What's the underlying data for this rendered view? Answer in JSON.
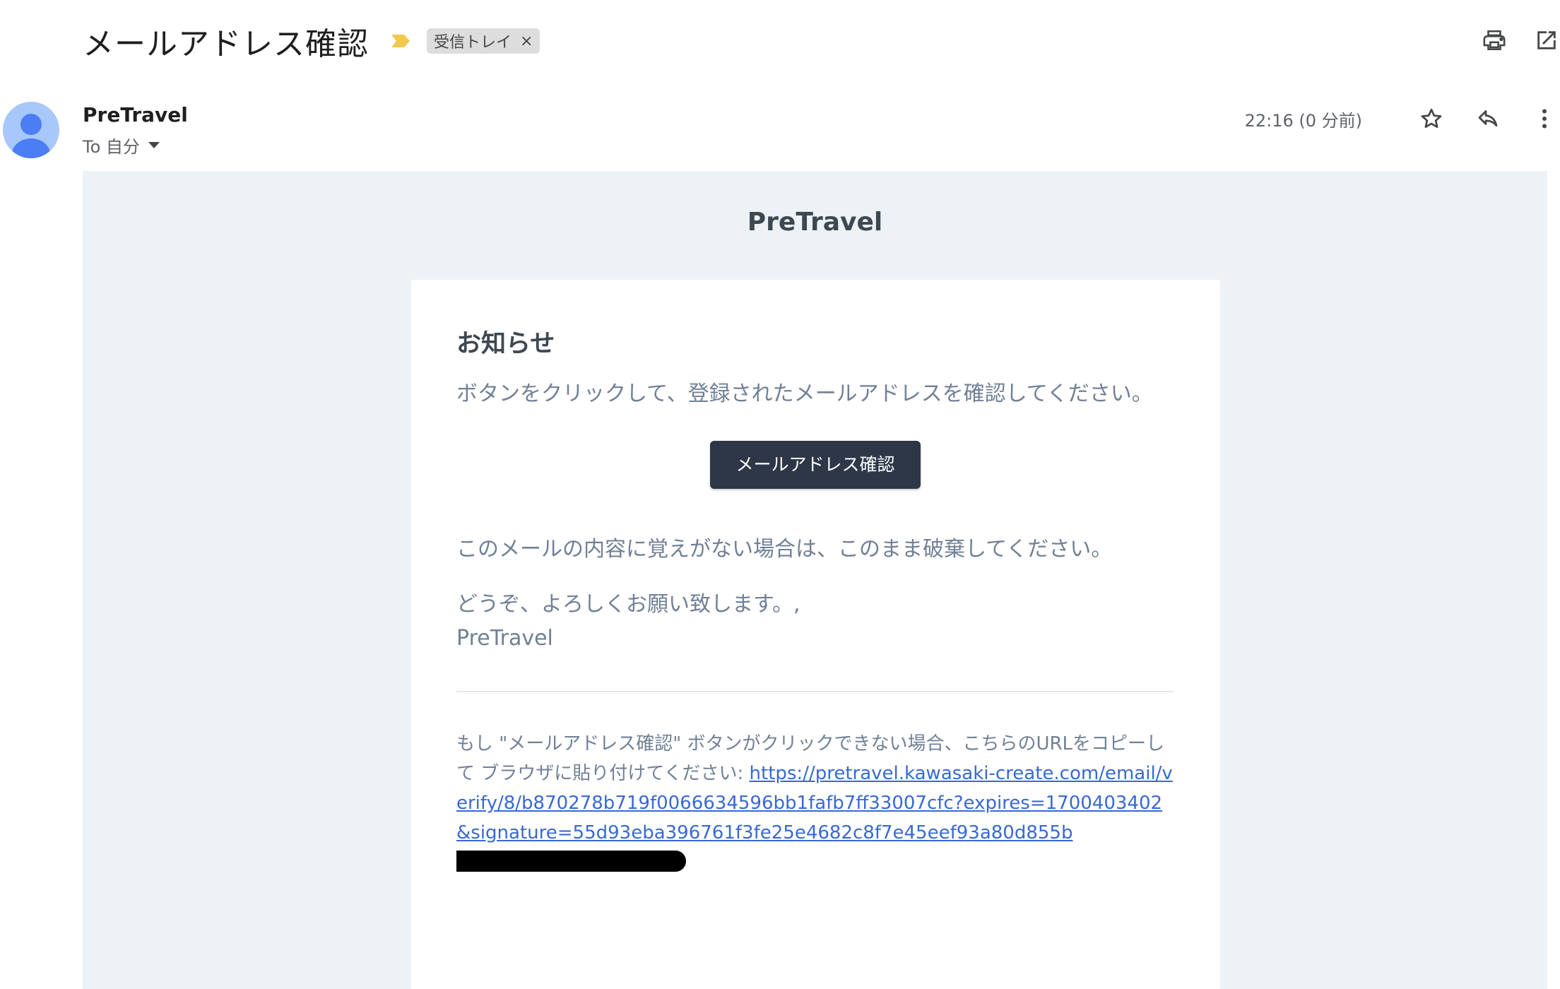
{
  "header": {
    "subject": "メールアドレス確認",
    "label_chip": "受信トレイ",
    "label_chip_remove": "×",
    "actions": [
      "print-icon",
      "open-in-new-window-icon"
    ]
  },
  "message": {
    "sender": "PreTravel",
    "to_line": "To 自分",
    "timestamp": "22:16 (0 分前)",
    "actions": [
      "star-icon",
      "reply-icon",
      "more-vert-icon"
    ]
  },
  "email": {
    "brand": "PreTravel",
    "heading": "お知らせ",
    "intro": "ボタンをクリックして、登録されたメールアドレスを確認してください。",
    "button_label": "メールアドレス確認",
    "ignore_text": "このメールの内容に覚えがない場合は、このまま破棄してください。",
    "closing": "どうぞ、よろしくお願い致します。,",
    "signature": "PreTravel",
    "subcopy_text": "もし \"メールアドレス確認\" ボタンがクリックできない場合、こちらのURLをコピーして ブラウザに貼り付けてください: ",
    "verify_url": "https://pretravel.kawasaki-create.com/email/verify/8/b870278b719f0066634596bb1fafb7ff33007cfc?expires=1700403402&signature=55d93eba396761f3fe25e4682c8f7e45eef93a80d855b"
  },
  "colors": {
    "email_background": "#edf2f7",
    "button": "#2d3748",
    "link": "#3869d4",
    "muted_text": "#718096",
    "avatar": "#a8c7fa",
    "importance_marker": "#f2c94c"
  }
}
